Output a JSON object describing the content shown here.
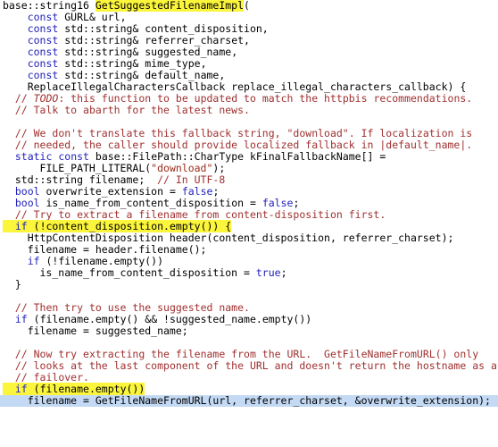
{
  "view": {
    "name": "source-code-viewer",
    "language": "C++",
    "background": "#ffffff",
    "highlight_color": "#fbf53c",
    "selection_color": "#c3d9f4",
    "comment_color": "#a03030",
    "keyword_color": "#2222bb",
    "string_color": "#9c2b1b",
    "text_color": "#000000"
  },
  "lines": [
    {
      "i": 0,
      "selected": false,
      "text": "base::string16 GetSuggestedFilenameImpl(",
      "tokens": [
        {
          "t": "base::string16 ",
          "c": "t-plain"
        },
        {
          "t": "GetSuggestedFilenameImpl",
          "c": "t-fn",
          "hl": true
        },
        {
          "t": "(",
          "c": "t-plain"
        }
      ]
    },
    {
      "i": 1,
      "selected": false,
      "text": "    const GURL& url,",
      "tokens": [
        {
          "t": "    ",
          "c": "t-plain"
        },
        {
          "t": "const",
          "c": "t-kw"
        },
        {
          "t": " GURL& url,",
          "c": "t-plain"
        }
      ]
    },
    {
      "i": 2,
      "selected": false,
      "text": "    const std::string& content_disposition,",
      "tokens": [
        {
          "t": "    ",
          "c": "t-plain"
        },
        {
          "t": "const",
          "c": "t-kw"
        },
        {
          "t": " std::string& content_disposition,",
          "c": "t-plain"
        }
      ]
    },
    {
      "i": 3,
      "selected": false,
      "text": "    const std::string& referrer_charset,",
      "tokens": [
        {
          "t": "    ",
          "c": "t-plain"
        },
        {
          "t": "const",
          "c": "t-kw"
        },
        {
          "t": " std::string& referrer_charset,",
          "c": "t-plain"
        }
      ]
    },
    {
      "i": 4,
      "selected": false,
      "text": "    const std::string& suggested_name,",
      "tokens": [
        {
          "t": "    ",
          "c": "t-plain"
        },
        {
          "t": "const",
          "c": "t-kw"
        },
        {
          "t": " std::string& suggested_name,",
          "c": "t-plain"
        }
      ]
    },
    {
      "i": 5,
      "selected": false,
      "text": "    const std::string& mime_type,",
      "tokens": [
        {
          "t": "    ",
          "c": "t-plain"
        },
        {
          "t": "const",
          "c": "t-kw"
        },
        {
          "t": " std::string& mime_type,",
          "c": "t-plain"
        }
      ]
    },
    {
      "i": 6,
      "selected": false,
      "text": "    const std::string& default_name,",
      "tokens": [
        {
          "t": "    ",
          "c": "t-plain"
        },
        {
          "t": "const",
          "c": "t-kw"
        },
        {
          "t": " std::string& default_name,",
          "c": "t-plain"
        }
      ]
    },
    {
      "i": 7,
      "selected": false,
      "text": "    ReplaceIllegalCharactersCallback replace_illegal_characters_callback) {",
      "tokens": [
        {
          "t": "    ReplaceIllegalCharactersCallback replace_illegal_characters_callback) {",
          "c": "t-plain"
        }
      ]
    },
    {
      "i": 8,
      "selected": false,
      "text": "  // TODO: this function to be updated to match the httpbis recommendations.",
      "tokens": [
        {
          "t": "  ",
          "c": "t-plain"
        },
        {
          "t": "// ",
          "c": "t-comment"
        },
        {
          "t": "TODO",
          "c": "t-comment-i"
        },
        {
          "t": ": this function to be updated to match the httpbis recommendations.",
          "c": "t-comment"
        }
      ]
    },
    {
      "i": 9,
      "selected": false,
      "text": "  // Talk to abarth for the latest news.",
      "tokens": [
        {
          "t": "  ",
          "c": "t-plain"
        },
        {
          "t": "// Talk to abarth for the latest news.",
          "c": "t-comment"
        }
      ]
    },
    {
      "i": 10,
      "selected": false,
      "text": "",
      "tokens": []
    },
    {
      "i": 11,
      "selected": false,
      "text": "  // We don't translate this fallback string, \"download\". If localization is",
      "tokens": [
        {
          "t": "  ",
          "c": "t-plain"
        },
        {
          "t": "// We don't translate this fallback string, \"download\". If localization is",
          "c": "t-comment"
        }
      ]
    },
    {
      "i": 12,
      "selected": false,
      "text": "  // needed, the caller should provide localized fallback in |default_name|.",
      "tokens": [
        {
          "t": "  ",
          "c": "t-plain"
        },
        {
          "t": "// needed, the caller should provide localized fallback in |default_name|.",
          "c": "t-comment"
        }
      ]
    },
    {
      "i": 13,
      "selected": false,
      "text": "  static const base::FilePath::CharType kFinalFallbackName[] =",
      "tokens": [
        {
          "t": "  ",
          "c": "t-plain"
        },
        {
          "t": "static",
          "c": "t-kw"
        },
        {
          "t": " ",
          "c": "t-plain"
        },
        {
          "t": "const",
          "c": "t-kw"
        },
        {
          "t": " base::FilePath::CharType kFinalFallbackName[] =",
          "c": "t-plain"
        }
      ]
    },
    {
      "i": 14,
      "selected": false,
      "text": "      FILE_PATH_LITERAL(\"download\");",
      "tokens": [
        {
          "t": "      FILE_PATH_LITERAL(",
          "c": "t-plain"
        },
        {
          "t": "\"download\"",
          "c": "t-string"
        },
        {
          "t": ");",
          "c": "t-plain"
        }
      ]
    },
    {
      "i": 15,
      "selected": false,
      "text": "  std::string filename;  // In UTF-8",
      "tokens": [
        {
          "t": "  std::string filename;  ",
          "c": "t-plain"
        },
        {
          "t": "// In UTF-8",
          "c": "t-comment"
        }
      ]
    },
    {
      "i": 16,
      "selected": false,
      "text": "  bool overwrite_extension = false;",
      "tokens": [
        {
          "t": "  ",
          "c": "t-plain"
        },
        {
          "t": "bool",
          "c": "t-kw"
        },
        {
          "t": " overwrite_extension = ",
          "c": "t-plain"
        },
        {
          "t": "false",
          "c": "t-const"
        },
        {
          "t": ";",
          "c": "t-plain"
        }
      ]
    },
    {
      "i": 17,
      "selected": false,
      "text": "  bool is_name_from_content_disposition = false;",
      "tokens": [
        {
          "t": "  ",
          "c": "t-plain"
        },
        {
          "t": "bool",
          "c": "t-kw"
        },
        {
          "t": " is_name_from_content_disposition = ",
          "c": "t-plain"
        },
        {
          "t": "false",
          "c": "t-const"
        },
        {
          "t": ";",
          "c": "t-plain"
        }
      ]
    },
    {
      "i": 18,
      "selected": false,
      "text": "  // Try to extract a filename from content-disposition first.",
      "tokens": [
        {
          "t": "  ",
          "c": "t-plain"
        },
        {
          "t": "// Try to extract a filename from content-disposition first.",
          "c": "t-comment"
        }
      ]
    },
    {
      "i": 19,
      "selected": false,
      "text": "  if (!content_disposition.empty()) {",
      "tokens": [
        {
          "t": "  ",
          "c": "t-plain",
          "hl": true
        },
        {
          "t": "if",
          "c": "t-kw",
          "hl": true
        },
        {
          "t": " (!content_disposition.empty()) {",
          "c": "t-plain",
          "hl": true
        }
      ]
    },
    {
      "i": 20,
      "selected": false,
      "text": "    HttpContentDisposition header(content_disposition, referrer_charset);",
      "tokens": [
        {
          "t": "    HttpContentDisposition header(content_disposition, referrer_charset);",
          "c": "t-plain"
        }
      ]
    },
    {
      "i": 21,
      "selected": false,
      "text": "    filename = header.filename();",
      "tokens": [
        {
          "t": "    filename = header.filename();",
          "c": "t-plain"
        }
      ]
    },
    {
      "i": 22,
      "selected": false,
      "text": "    if (!filename.empty())",
      "tokens": [
        {
          "t": "    ",
          "c": "t-plain"
        },
        {
          "t": "if",
          "c": "t-kw"
        },
        {
          "t": " (!filename.empty())",
          "c": "t-plain"
        }
      ]
    },
    {
      "i": 23,
      "selected": false,
      "text": "      is_name_from_content_disposition = true;",
      "tokens": [
        {
          "t": "      is_name_from_content_disposition = ",
          "c": "t-plain"
        },
        {
          "t": "true",
          "c": "t-const"
        },
        {
          "t": ";",
          "c": "t-plain"
        }
      ]
    },
    {
      "i": 24,
      "selected": false,
      "text": "  }",
      "tokens": [
        {
          "t": "  }",
          "c": "t-plain"
        }
      ]
    },
    {
      "i": 25,
      "selected": false,
      "text": "",
      "tokens": []
    },
    {
      "i": 26,
      "selected": false,
      "text": "  // Then try to use the suggested name.",
      "tokens": [
        {
          "t": "  ",
          "c": "t-plain"
        },
        {
          "t": "// Then try to use the suggested name.",
          "c": "t-comment"
        }
      ]
    },
    {
      "i": 27,
      "selected": false,
      "text": "  if (filename.empty() && !suggested_name.empty())",
      "tokens": [
        {
          "t": "  ",
          "c": "t-plain"
        },
        {
          "t": "if",
          "c": "t-kw"
        },
        {
          "t": " (filename.empty() && !suggested_name.empty())",
          "c": "t-plain"
        }
      ]
    },
    {
      "i": 28,
      "selected": false,
      "text": "    filename = suggested_name;",
      "tokens": [
        {
          "t": "    filename = suggested_name;",
          "c": "t-plain"
        }
      ]
    },
    {
      "i": 29,
      "selected": false,
      "text": "",
      "tokens": []
    },
    {
      "i": 30,
      "selected": false,
      "text": "  // Now try extracting the filename from the URL.  GetFileNameFromURL() only",
      "tokens": [
        {
          "t": "  ",
          "c": "t-plain"
        },
        {
          "t": "// Now try extracting the filename from the URL.  GetFileNameFromURL() only",
          "c": "t-comment"
        }
      ]
    },
    {
      "i": 31,
      "selected": false,
      "text": "  // looks at the last component of the URL and doesn't return the hostname as a",
      "tokens": [
        {
          "t": "  ",
          "c": "t-plain"
        },
        {
          "t": "// looks at the last component of the URL and doesn't return the hostname as a",
          "c": "t-comment"
        }
      ]
    },
    {
      "i": 32,
      "selected": false,
      "text": "  // failover.",
      "tokens": [
        {
          "t": "  ",
          "c": "t-plain"
        },
        {
          "t": "// failover.",
          "c": "t-comment"
        }
      ]
    },
    {
      "i": 33,
      "selected": false,
      "text": "  if (filename.empty())",
      "tokens": [
        {
          "t": "  ",
          "c": "t-plain",
          "hl": true
        },
        {
          "t": "if",
          "c": "t-kw",
          "hl": true
        },
        {
          "t": " (filename.empty())",
          "c": "t-plain",
          "hl": true
        }
      ]
    },
    {
      "i": 34,
      "selected": true,
      "text": "    filename = GetFileNameFromURL(url, referrer_charset, &overwrite_extension);",
      "tokens": [
        {
          "t": "    filename = GetFileNameFromURL(url, referrer_charset, &overwrite_extension);",
          "c": "t-plain"
        }
      ]
    }
  ]
}
